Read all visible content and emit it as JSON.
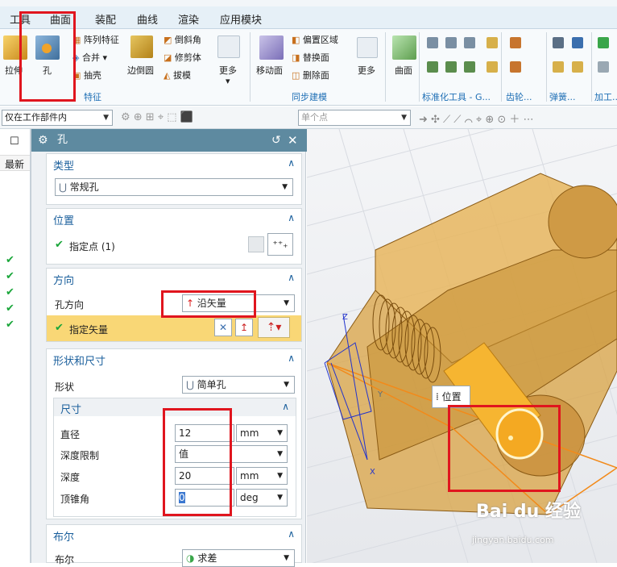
{
  "menu": [
    "工具",
    "曲面",
    "装配",
    "曲线",
    "渲染",
    "应用模块"
  ],
  "ribbon": {
    "feature": {
      "extrude": "拉伸",
      "hole": "孔",
      "pattern": "阵列特征",
      "combine": "合并",
      "shell": "抽壳",
      "edge_blend": "边倒圆",
      "chamfer": "倒斜角",
      "trim_body": "修剪体",
      "draft": "拔模",
      "more": "更多",
      "group": "特征"
    },
    "sync": {
      "move_face": "移动面",
      "offset_region": "偏置区域",
      "replace_face": "替换面",
      "delete_face": "删除面",
      "more": "更多",
      "group": "同步建模"
    },
    "surface": {
      "label": "曲面"
    },
    "std_parts": "标准化工具 - G...",
    "gear": "齿轮...",
    "spring": "弹簧...",
    "machining": "加工..."
  },
  "toolbar": {
    "scope": "仅在工作部件内",
    "filter_placeholder": "单个点"
  },
  "left_col": {
    "header": "最新"
  },
  "dialog": {
    "title": "孔",
    "type": {
      "header": "类型",
      "value": "常规孔"
    },
    "position": {
      "header": "位置",
      "specify_point": "指定点 (1)"
    },
    "direction": {
      "header": "方向",
      "hole_dir_label": "孔方向",
      "hole_dir_value": "沿矢量",
      "specify_vector": "指定矢量"
    },
    "shape": {
      "header": "形状和尺寸",
      "shape_label": "形状",
      "shape_value": "简单孔",
      "dims": {
        "header": "尺寸",
        "diameter_label": "直径",
        "diameter": "12",
        "diameter_unit": "mm",
        "depth_limit_label": "深度限制",
        "depth_limit": "值",
        "depth_label": "深度",
        "depth": "20",
        "depth_unit": "mm",
        "tip_angle_label": "顶锥角",
        "tip_angle": "0",
        "tip_angle_unit": "deg"
      }
    },
    "boolean": {
      "header": "布尔",
      "label": "布尔",
      "value": "求差"
    }
  },
  "viewport": {
    "tooltip": "位置",
    "axis_z": "Z",
    "axis_x": "X",
    "axis_y": "Y",
    "watermark": "Bai du 经验",
    "watermark_url": "jingyan.baidu.com"
  },
  "colors": {
    "accent": "#1a5f9c",
    "highlight": "#f9d776",
    "title_bar": "#5e8aa0",
    "check": "#1aa63a",
    "annotation": "#e0151e"
  }
}
